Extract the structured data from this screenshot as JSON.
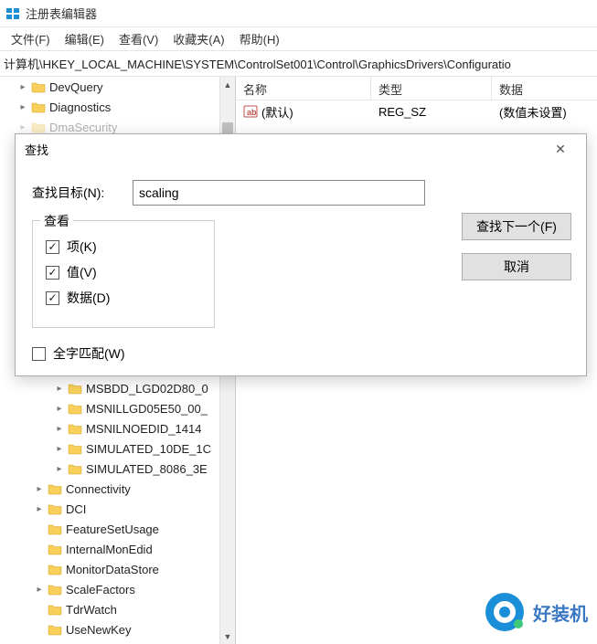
{
  "app": {
    "title": "注册表编辑器"
  },
  "menubar": {
    "items": [
      "文件(F)",
      "编辑(E)",
      "查看(V)",
      "收藏夹(A)",
      "帮助(H)"
    ]
  },
  "address": {
    "path": "计算机\\HKEY_LOCAL_MACHINE\\SYSTEM\\ControlSet001\\Control\\GraphicsDrivers\\Configuratio"
  },
  "tree": {
    "top_items": [
      {
        "label": "DevQuery",
        "indent": 18,
        "hasChildren": true
      },
      {
        "label": "Diagnostics",
        "indent": 18,
        "hasChildren": true
      },
      {
        "label": "DmaSecurity",
        "indent": 18,
        "hasChildren": true,
        "partial": true
      }
    ],
    "bottom_items": [
      {
        "label": "MSBDD_LGD02D80_0",
        "indent": 58,
        "hasChildren": true
      },
      {
        "label": "MSNILLGD05E50_00_",
        "indent": 58,
        "hasChildren": true
      },
      {
        "label": "MSNILNOEDID_1414",
        "indent": 58,
        "hasChildren": true
      },
      {
        "label": "SIMULATED_10DE_1C",
        "indent": 58,
        "hasChildren": true
      },
      {
        "label": "SIMULATED_8086_3E",
        "indent": 58,
        "hasChildren": true
      },
      {
        "label": "Connectivity",
        "indent": 36,
        "hasChildren": true
      },
      {
        "label": "DCI",
        "indent": 36,
        "hasChildren": true
      },
      {
        "label": "FeatureSetUsage",
        "indent": 36,
        "hasChildren": false
      },
      {
        "label": "InternalMonEdid",
        "indent": 36,
        "hasChildren": false
      },
      {
        "label": "MonitorDataStore",
        "indent": 36,
        "hasChildren": false
      },
      {
        "label": "ScaleFactors",
        "indent": 36,
        "hasChildren": true
      },
      {
        "label": "TdrWatch",
        "indent": 36,
        "hasChildren": false
      },
      {
        "label": "UseNewKey",
        "indent": 36,
        "hasChildren": false
      }
    ]
  },
  "list": {
    "headers": {
      "name": "名称",
      "type": "类型",
      "data": "数据"
    },
    "rows": [
      {
        "name": "(默认)",
        "type": "REG_SZ",
        "data": "(数值未设置)"
      }
    ]
  },
  "dialog": {
    "title": "查找",
    "find_label": "查找目标(N):",
    "find_value": "scaling",
    "groupbox_label": "查看",
    "option_key": "项(K)",
    "option_value": "值(V)",
    "option_data": "数据(D)",
    "whole_word": "全字匹配(W)",
    "btn_next": "查找下一个(F)",
    "btn_cancel": "取消"
  },
  "watermark": {
    "text": "好装机"
  },
  "colors": {
    "folder": "#f7cf5a",
    "accent": "#1a8fd8"
  }
}
